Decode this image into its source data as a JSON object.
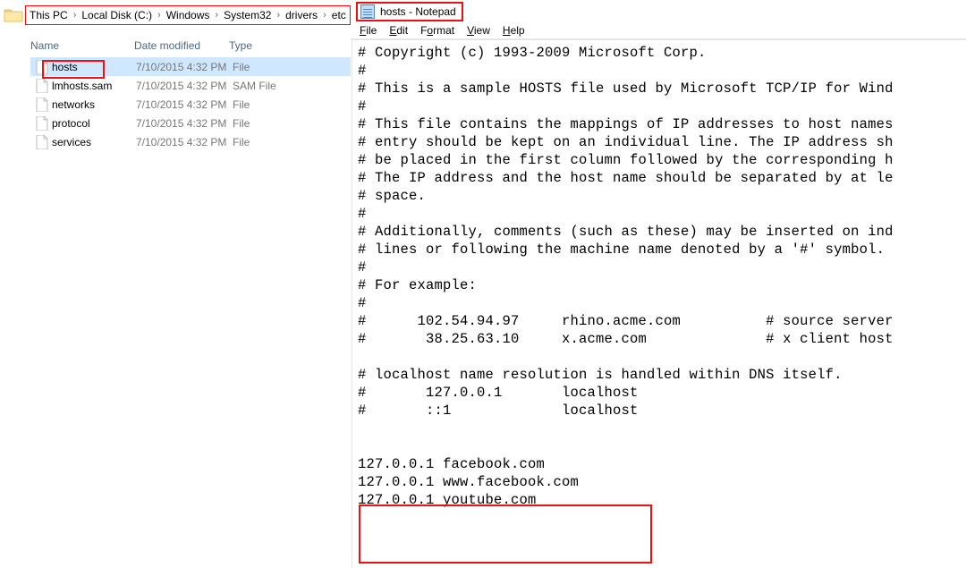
{
  "explorer": {
    "breadcrumb": [
      "This PC",
      "Local Disk (C:)",
      "Windows",
      "System32",
      "drivers",
      "etc"
    ],
    "headers": {
      "name": "Name",
      "date": "Date modified",
      "type": "Type"
    },
    "files": [
      {
        "name": "hosts",
        "date": "7/10/2015 4:32 PM",
        "type": "File",
        "highlight": true
      },
      {
        "name": "lmhosts.sam",
        "date": "7/10/2015 4:32 PM",
        "type": "SAM File",
        "highlight": false
      },
      {
        "name": "networks",
        "date": "7/10/2015 4:32 PM",
        "type": "File",
        "highlight": false
      },
      {
        "name": "protocol",
        "date": "7/10/2015 4:32 PM",
        "type": "File",
        "highlight": false
      },
      {
        "name": "services",
        "date": "7/10/2015 4:32 PM",
        "type": "File",
        "highlight": false
      }
    ]
  },
  "notepad": {
    "title": "hosts - Notepad",
    "menu": [
      "File",
      "Edit",
      "Format",
      "View",
      "Help"
    ],
    "content": "# Copyright (c) 1993-2009 Microsoft Corp.\n#\n# This is a sample HOSTS file used by Microsoft TCP/IP for Wind\n#\n# This file contains the mappings of IP addresses to host names\n# entry should be kept on an individual line. The IP address sh\n# be placed in the first column followed by the corresponding h\n# The IP address and the host name should be separated by at le\n# space.\n#\n# Additionally, comments (such as these) may be inserted on ind\n# lines or following the machine name denoted by a '#' symbol.\n#\n# For example:\n#\n#      102.54.94.97     rhino.acme.com          # source server\n#       38.25.63.10     x.acme.com              # x client host\n\n# localhost name resolution is handled within DNS itself.\n#       127.0.0.1       localhost\n#       ::1             localhost\n\n\n127.0.0.1 facebook.com\n127.0.0.1 www.facebook.com\n127.0.0.1 youtube.com"
  }
}
